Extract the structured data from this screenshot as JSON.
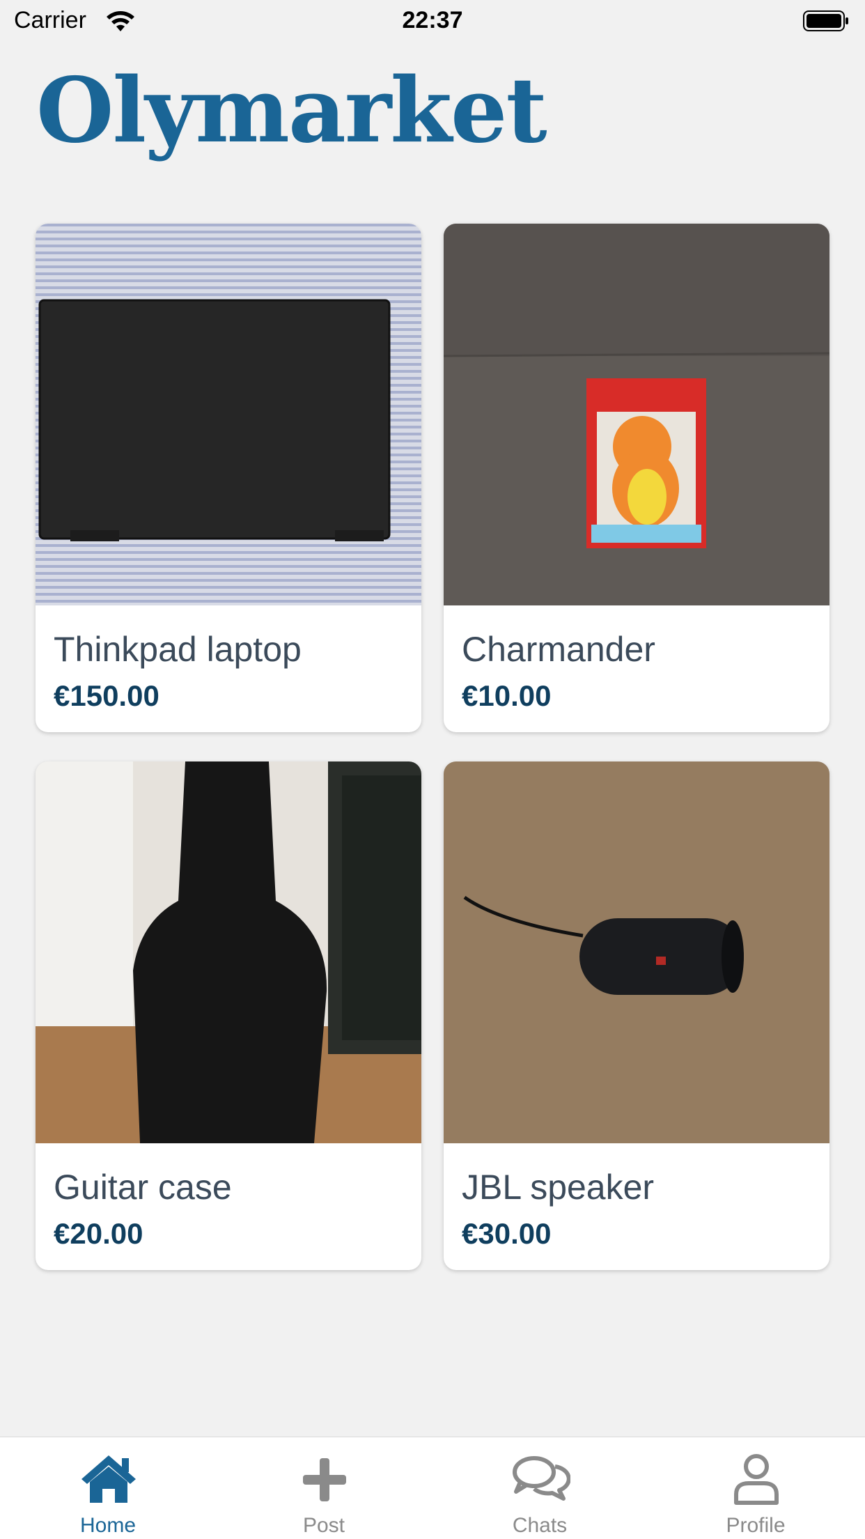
{
  "status_bar": {
    "carrier": "Carrier",
    "time": "22:37"
  },
  "app": {
    "title": "Olymarket"
  },
  "listings": [
    {
      "name": "Thinkpad laptop",
      "price": "€150.00"
    },
    {
      "name": "Charmander",
      "price": "€10.00"
    },
    {
      "name": "Guitar case",
      "price": "€20.00"
    },
    {
      "name": "JBL speaker",
      "price": "€30.00"
    }
  ],
  "tabs": [
    {
      "label": "Home",
      "icon": "home-icon",
      "active": true
    },
    {
      "label": "Post",
      "icon": "plus-icon",
      "active": false
    },
    {
      "label": "Chats",
      "icon": "chat-bubbles-icon",
      "active": false
    },
    {
      "label": "Profile",
      "icon": "person-icon",
      "active": false
    }
  ],
  "colors": {
    "brand": "#1a6596",
    "price": "#0f3e5e",
    "inactive_tab": "#8a8a8a"
  }
}
